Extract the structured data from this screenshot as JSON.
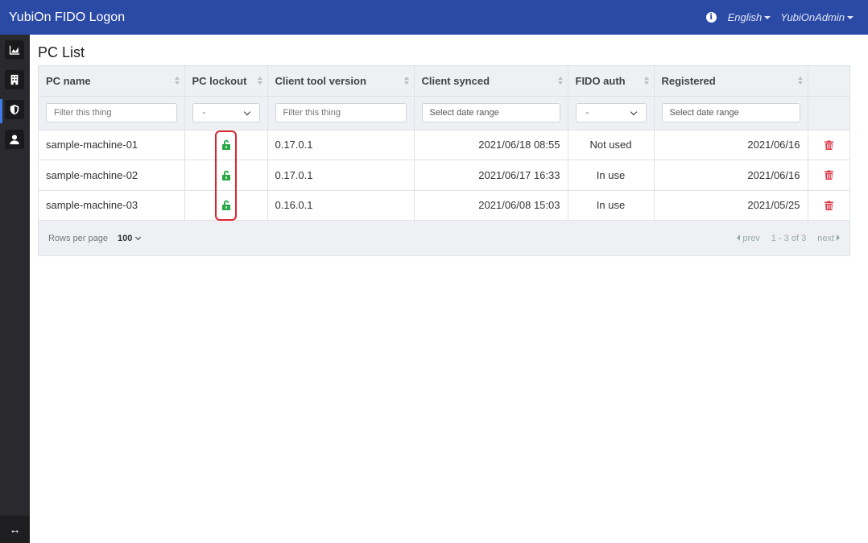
{
  "app": {
    "brand": "YubiOn FIDO Logon",
    "language": "English",
    "user": "YubiOnAdmin"
  },
  "sidebar": {
    "items": [
      {
        "icon": "chart-icon"
      },
      {
        "icon": "building-icon"
      },
      {
        "icon": "shield-icon",
        "active": true
      },
      {
        "icon": "user-icon"
      }
    ],
    "bottom_icon": "expand-arrows-icon"
  },
  "page": {
    "title": "PC List"
  },
  "table": {
    "columns": [
      "PC name",
      "PC lockout",
      "Client tool version",
      "Client synced",
      "FIDO auth",
      "Registered"
    ],
    "filters": {
      "pc_name_placeholder": "Filter this thing",
      "lockout_value": "-",
      "version_placeholder": "Filter this thing",
      "synced_placeholder": "Select date range",
      "fido_value": "-",
      "registered_placeholder": "Select date range"
    },
    "rows": [
      {
        "pc_name": "sample-machine-01",
        "lockout": "unlocked",
        "version": "0.17.0.1",
        "synced": "2021/06/18 08:55",
        "fido": "Not used",
        "registered": "2021/06/16"
      },
      {
        "pc_name": "sample-machine-02",
        "lockout": "unlocked",
        "version": "0.17.0.1",
        "synced": "2021/06/17 16:33",
        "fido": "In use",
        "registered": "2021/06/16"
      },
      {
        "pc_name": "sample-machine-03",
        "lockout": "unlocked",
        "version": "0.16.0.1",
        "synced": "2021/06/08 15:03",
        "fido": "In use",
        "registered": "2021/05/25"
      }
    ]
  },
  "footer": {
    "rows_per_page_label": "Rows per page",
    "rows_per_page_value": "100",
    "prev": "prev",
    "range": "1 - 3 of 3",
    "next": "next"
  },
  "colors": {
    "header_bg": "#2b4aa6",
    "lock_green": "#28a745",
    "trash_red": "#dc3545",
    "highlight_red": "#d9262f"
  }
}
